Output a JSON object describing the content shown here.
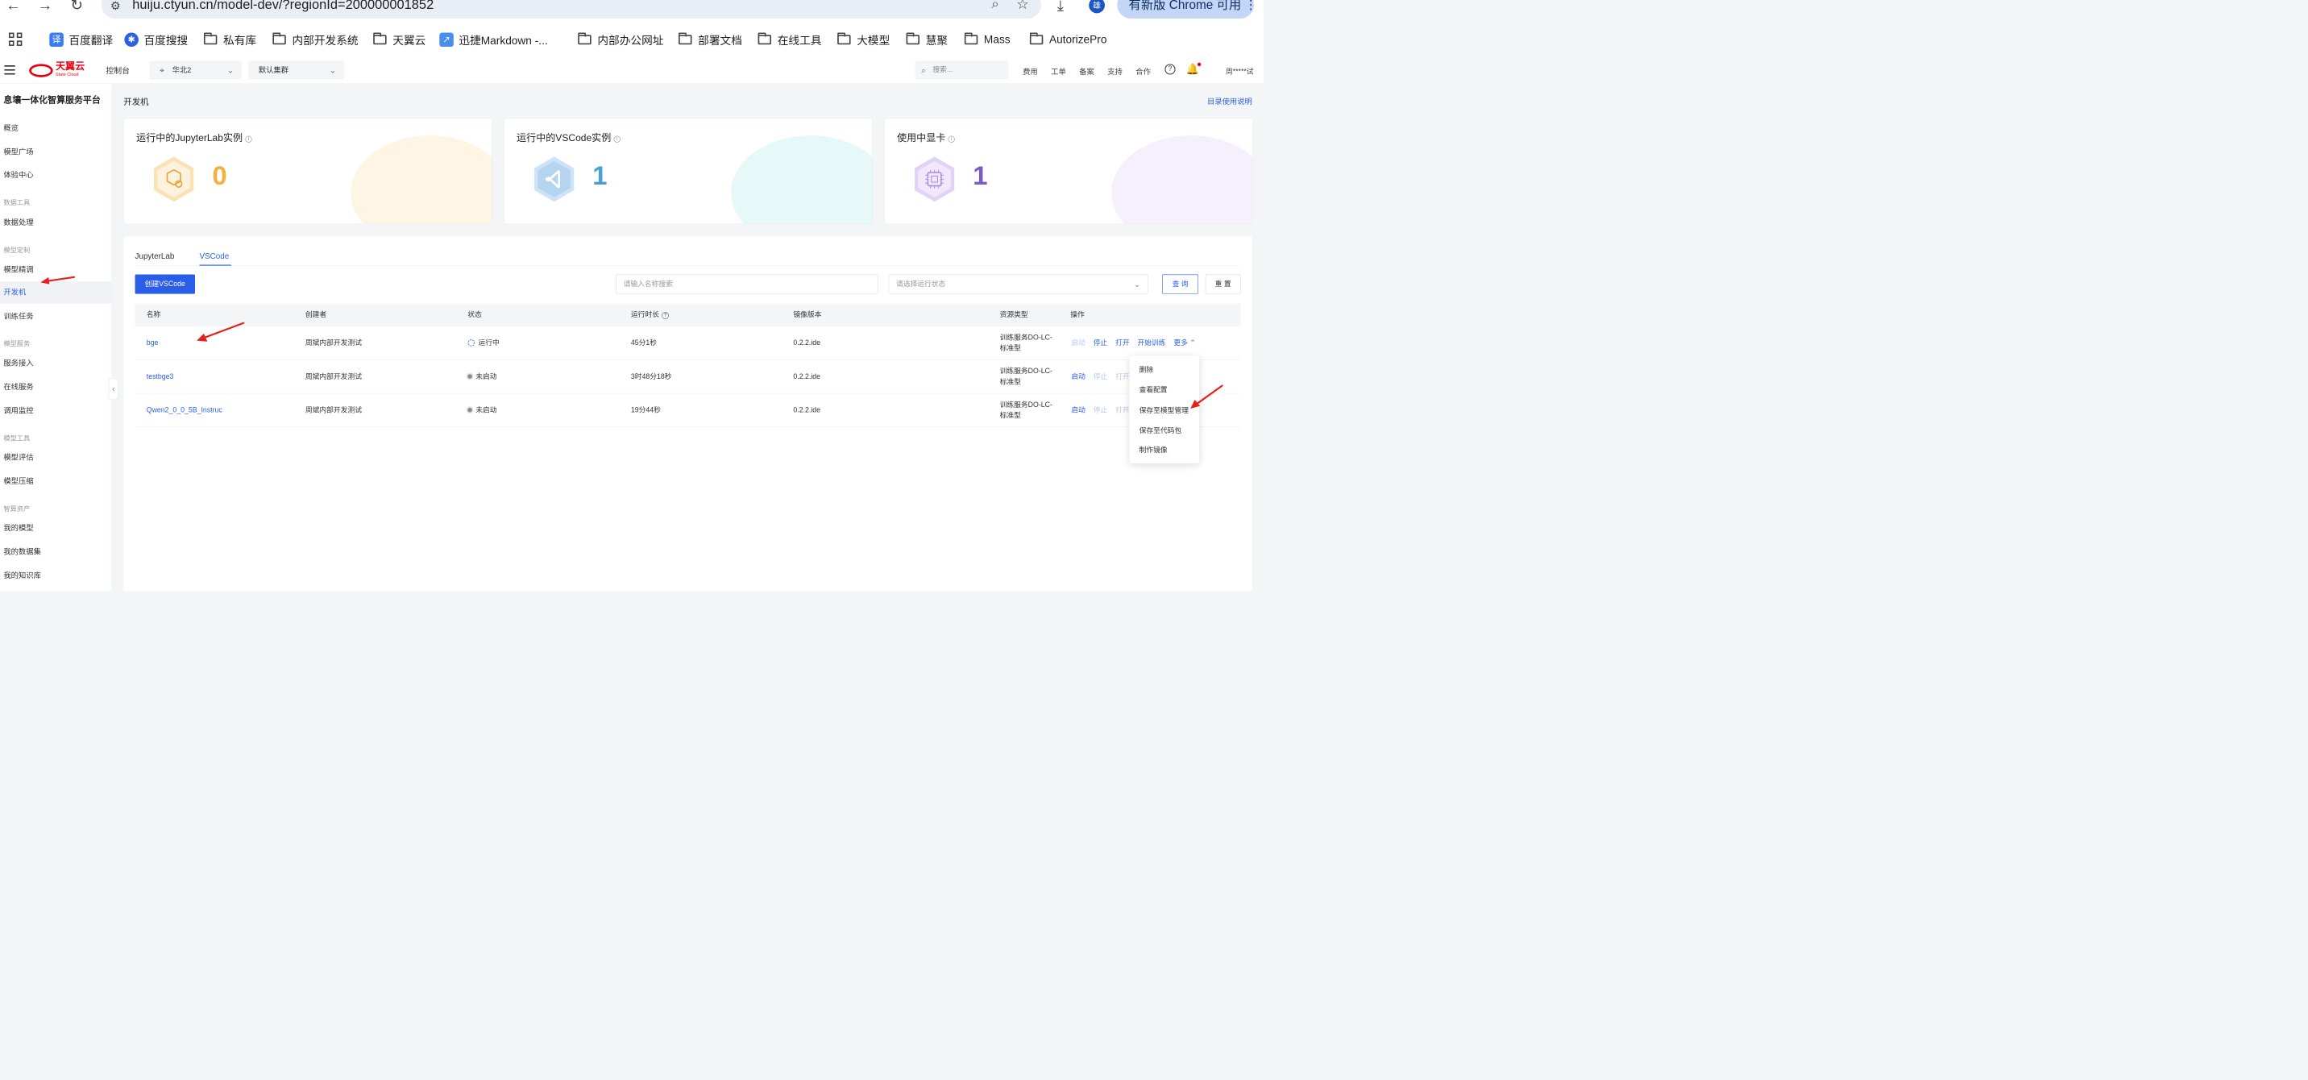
{
  "browser": {
    "url": "huiju.ctyun.cn/model-dev/?regionId=200000001852",
    "avatar_letter": "雄",
    "update_label": "有新版 Chrome 可用",
    "bookmarks": [
      "百度翻译",
      "百度搜搜",
      "私有库",
      "内部开发系统",
      "天翼云",
      "迅捷Markdown -...",
      "内部办公网址",
      "部署文档",
      "在线工具",
      "大模型",
      "慧聚",
      "Mass",
      "AutorizePro"
    ]
  },
  "topbar": {
    "logo_text": "天翼云",
    "logo_sub": "State Cloud",
    "console": "控制台",
    "region": "华北2",
    "cluster": "默认集群",
    "search_placeholder": "搜索...",
    "links": [
      "费用",
      "工单",
      "备案",
      "支持",
      "合作"
    ],
    "user": "周*****试"
  },
  "sidebar": {
    "title": "息壤一体化智算服务平台",
    "items": [
      {
        "type": "item",
        "label": "概览"
      },
      {
        "type": "item",
        "label": "模型广场"
      },
      {
        "type": "item",
        "label": "体验中心"
      },
      {
        "type": "group",
        "label": "数据工具"
      },
      {
        "type": "item",
        "label": "数据处理"
      },
      {
        "type": "group",
        "label": "模型定制"
      },
      {
        "type": "item",
        "label": "模型精调"
      },
      {
        "type": "item",
        "label": "开发机",
        "active": true
      },
      {
        "type": "item",
        "label": "训练任务"
      },
      {
        "type": "group",
        "label": "模型服务"
      },
      {
        "type": "item",
        "label": "服务接入"
      },
      {
        "type": "item",
        "label": "在线服务"
      },
      {
        "type": "item",
        "label": "调用监控"
      },
      {
        "type": "group",
        "label": "模型工具"
      },
      {
        "type": "item",
        "label": "模型评估"
      },
      {
        "type": "item",
        "label": "模型压缩"
      },
      {
        "type": "group",
        "label": "智算资产"
      },
      {
        "type": "item",
        "label": "我的模型"
      },
      {
        "type": "item",
        "label": "我的数据集"
      },
      {
        "type": "item",
        "label": "我的知识库"
      }
    ]
  },
  "page": {
    "title": "开发机",
    "doc_link": "目录使用说明"
  },
  "cards": [
    {
      "title": "运行中的JupyterLab实例",
      "value": "0",
      "color": "#f0b23c",
      "accent": "#fbe2b5"
    },
    {
      "title": "运行中的VSCode实例",
      "value": "1",
      "color": "#4a9fd8",
      "accent": "#b8ecea"
    },
    {
      "title": "使用中显卡",
      "value": "1",
      "color": "#7a5bc9",
      "accent": "#e2d3f6"
    }
  ],
  "tabs": [
    "JupyterLab",
    "VSCode"
  ],
  "toolbar": {
    "create_label": "创建VSCode",
    "name_placeholder": "请输入名称搜索",
    "status_placeholder": "请选择运行状态",
    "query_label": "查 询",
    "reset_label": "重 置"
  },
  "table": {
    "headers": [
      "名称",
      "创建者",
      "状态",
      "运行时长",
      "镜像版本",
      "资源类型",
      "操作"
    ],
    "rows": [
      {
        "name": "bge",
        "creator": "周斌内部开发测试",
        "status": "运行中",
        "running": true,
        "duration": "45分1秒",
        "image": "0.2.2.ide",
        "resource": [
          "训练服务DO-LC-",
          "标准型"
        ],
        "ops": [
          "启动",
          "停止",
          "打开",
          "开始训练",
          "更多"
        ]
      },
      {
        "name": "testbge3",
        "creator": "周斌内部开发测试",
        "status": "未启动",
        "running": false,
        "duration": "3时48分18秒",
        "image": "0.2.2.ide",
        "resource": [
          "训练服务DO-LC-",
          "标准型"
        ],
        "ops": [
          "启动",
          "停止",
          "打开"
        ]
      },
      {
        "name": "Qwen2_0_0_5B_Instruc",
        "creator": "周斌内部开发测试",
        "status": "未启动",
        "running": false,
        "duration": "19分44秒",
        "image": "0.2.2.ide",
        "resource": [
          "训练服务DO-LC-",
          "标准型"
        ],
        "ops": [
          "启动",
          "停止",
          "打开"
        ]
      }
    ]
  },
  "more_menu": [
    "删除",
    "查看配置",
    "保存至模型管理",
    "保存至代码包",
    "制作镜像"
  ],
  "colors": {
    "accent": "#2a5ee8",
    "annotation_arrow": "#e8201c",
    "brand": "#e60012"
  }
}
